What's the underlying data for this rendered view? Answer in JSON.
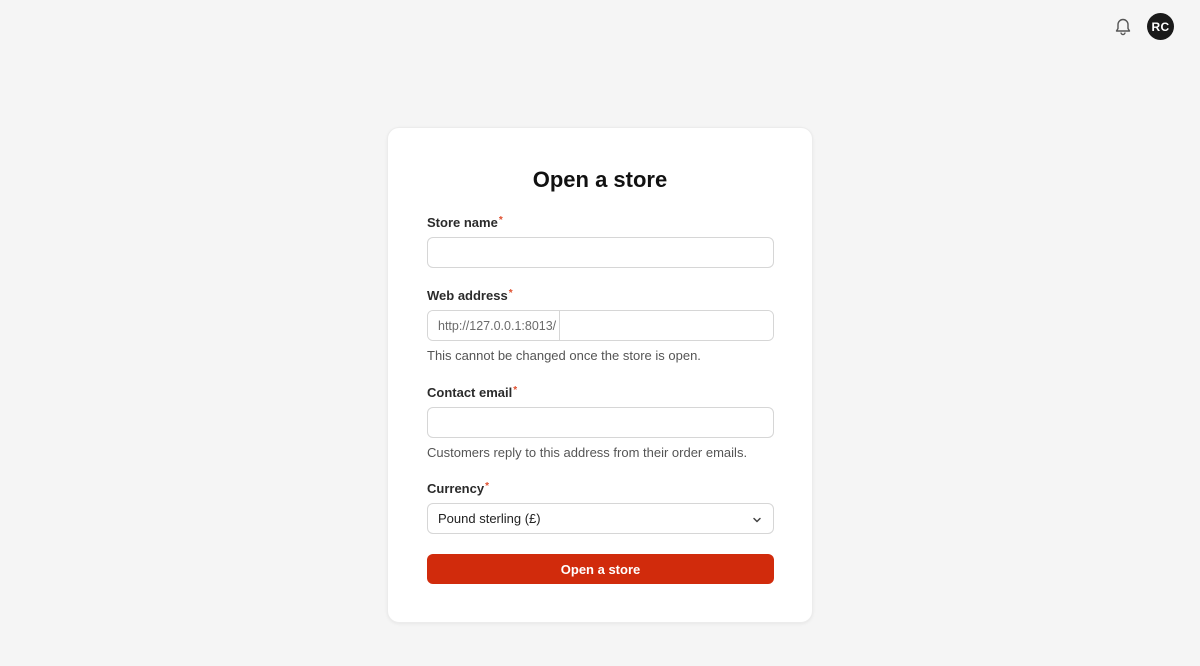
{
  "header": {
    "bell_icon": "bell-icon",
    "avatar_initials": "RC"
  },
  "form": {
    "title": "Open a store",
    "store_name": {
      "label": "Store name",
      "required_mark": "*",
      "value": "",
      "placeholder": ""
    },
    "web_address": {
      "label": "Web address",
      "required_mark": "*",
      "prefix": "http://127.0.0.1:8013/",
      "value": "",
      "placeholder": "",
      "help": "This cannot be changed once the store is open."
    },
    "contact_email": {
      "label": "Contact email",
      "required_mark": "*",
      "value": "",
      "placeholder": "",
      "help": "Customers reply to this address from their order emails."
    },
    "currency": {
      "label": "Currency",
      "required_mark": "*",
      "selected": "Pound sterling (£)"
    },
    "submit_label": "Open a store"
  },
  "colors": {
    "accent": "#d12b0c",
    "required": "#e04f2e"
  }
}
